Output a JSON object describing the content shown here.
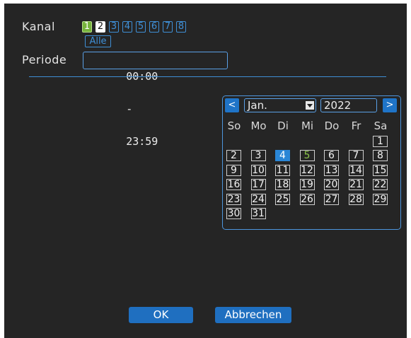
{
  "labels": {
    "kanal": "Kanal",
    "periode": "Periode"
  },
  "channels": [
    "1",
    "2",
    "3",
    "4",
    "5",
    "6",
    "7",
    "8"
  ],
  "alle": "Alle",
  "periode": {
    "start": "00:00",
    "separator": "-",
    "end": "23:59"
  },
  "calendar": {
    "prev": "<",
    "next": ">",
    "month": "Jan.",
    "year": "2022",
    "weekdays": [
      "So",
      "Mo",
      "Di",
      "Mi",
      "Do",
      "Fr",
      "Sa"
    ],
    "days": [
      "1",
      "2",
      "3",
      "4",
      "5",
      "6",
      "7",
      "8",
      "9",
      "10",
      "11",
      "12",
      "13",
      "14",
      "15",
      "16",
      "17",
      "18",
      "19",
      "20",
      "21",
      "22",
      "23",
      "24",
      "25",
      "26",
      "27",
      "28",
      "29",
      "30",
      "31"
    ],
    "selected_day": "4",
    "today_day": "5"
  },
  "buttons": {
    "ok": "OK",
    "cancel": "Abbrechen"
  },
  "colors": {
    "panel": "#252525",
    "accent": "#2a86d6",
    "channel_active": "#77b43c",
    "today": "#8bc34a"
  }
}
